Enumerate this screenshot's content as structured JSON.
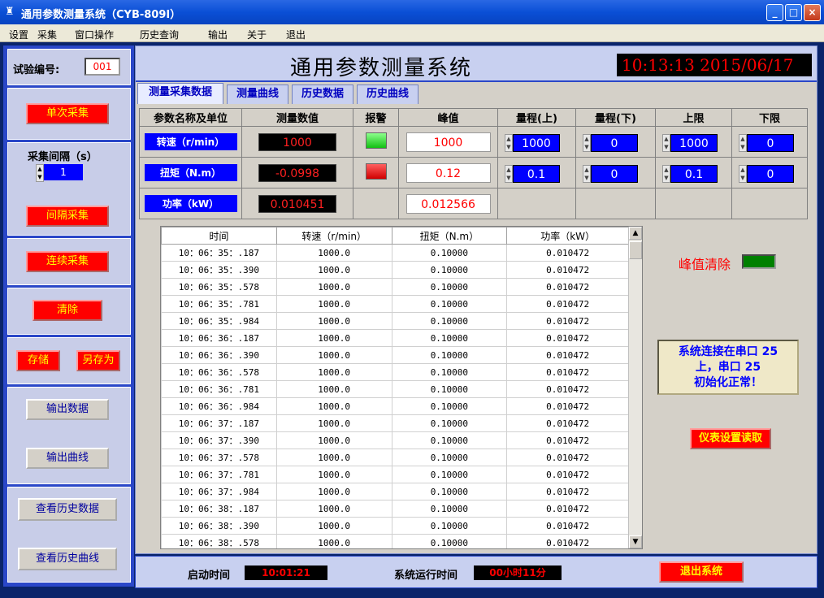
{
  "window": {
    "title": "通用参数测量系统（CYB-809I）",
    "minimize_glyph": "_",
    "maximize_glyph": "□",
    "close_glyph": "×"
  },
  "menu": [
    "设置",
    "采集",
    "窗口操作",
    "历史查询",
    "输出",
    "关于",
    "退出"
  ],
  "sidebar": {
    "test_no_label": "试验编号:",
    "test_no_value": "001",
    "single_collect": "单次采集",
    "interval_label": "采集间隔（s）",
    "interval_value": "1",
    "interval_collect": "间隔采集",
    "continuous_collect": "连续采集",
    "clear": "清除",
    "save": "存储",
    "save_as": "另存为",
    "export_data": "输出数据",
    "export_curve": "输出曲线",
    "view_history_data": "查看历史数据",
    "view_history_curve": "查看历史曲线"
  },
  "header": {
    "system_title": "通用参数测量系统",
    "clock": "10:13:13  2015/06/17"
  },
  "tabs": [
    "测量采集数据",
    "测量曲线",
    "历史数据",
    "历史曲线"
  ],
  "params": {
    "columns": [
      "参数名称及单位",
      "测量数值",
      "报警",
      "峰值",
      "量程(上)",
      "量程(下)",
      "上限",
      "下限"
    ],
    "rows": [
      {
        "name": "转速（r/min）",
        "value": "1000",
        "alarm": "green",
        "peak": "1000",
        "range_high": "1000",
        "range_low": "0",
        "upper": "1000",
        "lower": "0"
      },
      {
        "name": "扭矩（N.m）",
        "value": "-0.0998",
        "alarm": "red",
        "peak": "0.12",
        "range_high": "0.1",
        "range_low": "0",
        "upper": "0.1",
        "lower": "0"
      },
      {
        "name": "功率（kW）",
        "value": "0.010451",
        "peak": "0.012566"
      }
    ]
  },
  "data_table": {
    "headers": [
      "时间",
      "转速（r/min）",
      "扭矩（N.m）",
      "功率（kW）"
    ],
    "rows": [
      [
        "10：06：35：.187",
        "1000.0",
        "0.10000",
        "0.010472"
      ],
      [
        "10：06：35：.390",
        "1000.0",
        "0.10000",
        "0.010472"
      ],
      [
        "10：06：35：.578",
        "1000.0",
        "0.10000",
        "0.010472"
      ],
      [
        "10：06：35：.781",
        "1000.0",
        "0.10000",
        "0.010472"
      ],
      [
        "10：06：35：.984",
        "1000.0",
        "0.10000",
        "0.010472"
      ],
      [
        "10：06：36：.187",
        "1000.0",
        "0.10000",
        "0.010472"
      ],
      [
        "10：06：36：.390",
        "1000.0",
        "0.10000",
        "0.010472"
      ],
      [
        "10：06：36：.578",
        "1000.0",
        "0.10000",
        "0.010472"
      ],
      [
        "10：06：36：.781",
        "1000.0",
        "0.10000",
        "0.010472"
      ],
      [
        "10：06：36：.984",
        "1000.0",
        "0.10000",
        "0.010472"
      ],
      [
        "10：06：37：.187",
        "1000.0",
        "0.10000",
        "0.010472"
      ],
      [
        "10：06：37：.390",
        "1000.0",
        "0.10000",
        "0.010472"
      ],
      [
        "10：06：37：.578",
        "1000.0",
        "0.10000",
        "0.010472"
      ],
      [
        "10：06：37：.781",
        "1000.0",
        "0.10000",
        "0.010472"
      ],
      [
        "10：06：37：.984",
        "1000.0",
        "0.10000",
        "0.010472"
      ],
      [
        "10：06：38：.187",
        "1000.0",
        "0.10000",
        "0.010472"
      ],
      [
        "10：06：38：.390",
        "1000.0",
        "0.10000",
        "0.010472"
      ],
      [
        "10：06：38：.578",
        "1000.0",
        "0.10000",
        "0.010472"
      ]
    ]
  },
  "right_panel": {
    "peak_clear_label": "峰值清除",
    "status_line1": "系统连接在串口 25",
    "status_line2": "上，串口 25",
    "status_line3": "初始化正常！",
    "meter_settings": "仪表设置读取"
  },
  "bottom": {
    "start_time_label": "启动时间",
    "start_time_value": "10:01:21",
    "runtime_label": "系统运行时间",
    "runtime_value": "00小时11分",
    "exit_button": "退出系统"
  },
  "colors": {
    "accent_blue": "#2a47c8",
    "alarm_red": "#ff0000",
    "alarm_green": "#12c012"
  }
}
